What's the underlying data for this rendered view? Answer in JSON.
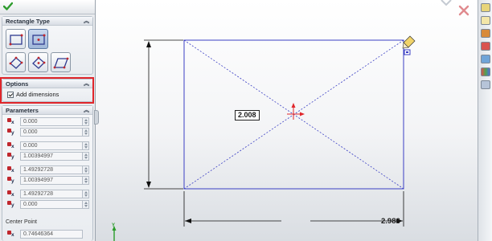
{
  "property_manager": {
    "ok_icon": "green-checkmark-icon",
    "rectangle_type": {
      "title": "Rectangle Type",
      "buttons": [
        "corner-rectangle-icon",
        "center-rectangle-icon",
        "3-point-corner-rectangle-icon",
        "3-point-center-rectangle-icon",
        "parallelogram-icon"
      ],
      "selected": "center-rectangle-icon"
    },
    "options": {
      "title": "Options",
      "add_dimensions_label": "Add dimensions",
      "add_dimensions_checked": true
    },
    "parameters": {
      "title": "Parameters",
      "rows": [
        {
          "axis": "x",
          "value": "0.000"
        },
        {
          "axis": "y",
          "value": "0.000"
        },
        {
          "axis": "x",
          "value": "0.000"
        },
        {
          "axis": "y",
          "value": "1.00394997"
        },
        {
          "axis": "x",
          "value": "1.49292728"
        },
        {
          "axis": "y",
          "value": "1.00394997"
        },
        {
          "axis": "x",
          "value": "1.49292728"
        },
        {
          "axis": "y",
          "value": "0.000"
        }
      ],
      "center_point_label": "Center Point",
      "center_point_value": "0.74646364"
    }
  },
  "canvas": {
    "dimension_height": "2.008",
    "dimension_width": "2.986",
    "sketch_color": "#3b3fc4",
    "origin_color": "#e0262b",
    "highlight_color": "#e0262b",
    "origin_axis_label": "Y"
  },
  "heads_up_icons": [
    "confirm-corner-icon",
    "cancel-x-icon"
  ],
  "task_pane_icons": [
    "resources-icon",
    "design-library-icon",
    "file-explorer-icon",
    "search-icon",
    "view-palette-icon",
    "appearances-icon",
    "custom-properties-icon"
  ]
}
